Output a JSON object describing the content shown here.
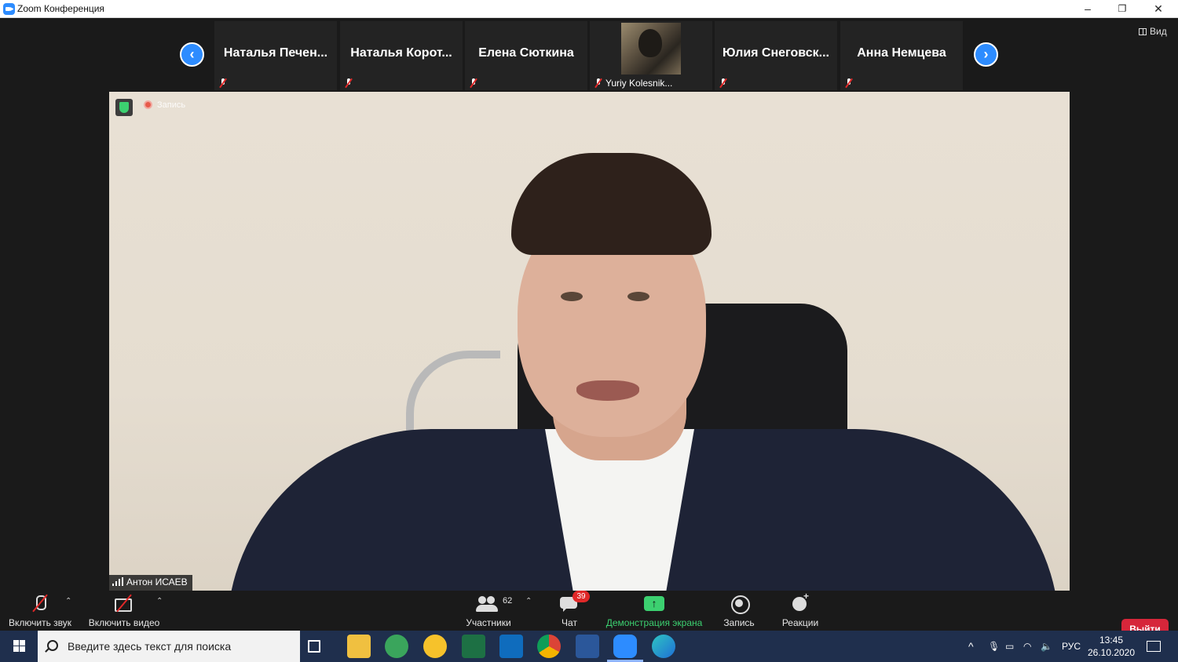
{
  "window": {
    "title": "Zoom Конференция",
    "minimize": "–",
    "restore": "❐",
    "close": "✕"
  },
  "view_button": "Вид",
  "participants_strip": {
    "prev_arrow": "‹",
    "next_arrow": "›",
    "tiles": [
      {
        "name": "Наталья  Печен..."
      },
      {
        "name": "Наталья  Корот..."
      },
      {
        "name": "Елена Сюткина"
      },
      {
        "name": "Yuriy Kolesnik..."
      },
      {
        "name": "Юлия  Снеговск..."
      },
      {
        "name": "Анна Немцева"
      }
    ]
  },
  "main_video": {
    "recording_label": "Запись",
    "speaker_name": "Антон ИСАЕВ"
  },
  "toolbar": {
    "unmute_label": "Включить звук",
    "start_video_label": "Включить видео",
    "participants_label": "Участники",
    "participants_count": "62",
    "chat_label": "Чат",
    "chat_badge": "39",
    "share_label": "Демонстрация экрана",
    "record_label": "Запись",
    "reactions_label": "Реакции",
    "leave_label": "Выйти",
    "caret": "⌃"
  },
  "taskbar": {
    "search_placeholder": "Введите здесь текст для поиска",
    "language": "РУС",
    "time": "13:45",
    "date": "26.10.2020"
  },
  "colors": {
    "zoom_blue": "#2d8cff",
    "share_green": "#3cd070",
    "leave_red": "#d6263a",
    "taskbar": "#1f2f4d"
  }
}
